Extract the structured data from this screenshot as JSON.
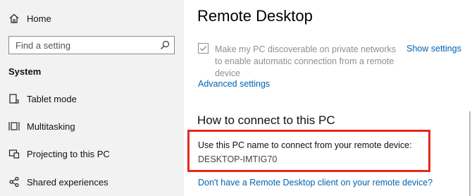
{
  "sidebar": {
    "home": {
      "label": "Home",
      "icon": "home-icon"
    },
    "search": {
      "placeholder": "Find a setting",
      "icon": "search-icon"
    },
    "section_title": "System",
    "items": [
      {
        "label": "Tablet mode",
        "icon": "tablet-mode-icon"
      },
      {
        "label": "Multitasking",
        "icon": "multitasking-icon"
      },
      {
        "label": "Projecting to this PC",
        "icon": "projecting-icon"
      },
      {
        "label": "Shared experiences",
        "icon": "shared-experiences-icon"
      }
    ]
  },
  "main": {
    "title": "Remote Desktop",
    "discoverable": {
      "checked": true,
      "disabled": true,
      "label": "Make my PC discoverable on private networks to enable automatic connection from a remote device"
    },
    "show_settings_link": "Show settings",
    "advanced_settings_link": "Advanced settings",
    "connect_heading": "How to connect to this PC",
    "use_name_text": "Use this PC name to connect from your remote device:",
    "pc_name": "DESKTOP-IMTIG70",
    "client_link": "Don't have a Remote Desktop client on your remote device?"
  },
  "colors": {
    "sidebar_bg": "#f2f2f2",
    "link": "#0063b1",
    "highlight_border": "#e5291c",
    "disabled_text": "#8f8f8f"
  }
}
